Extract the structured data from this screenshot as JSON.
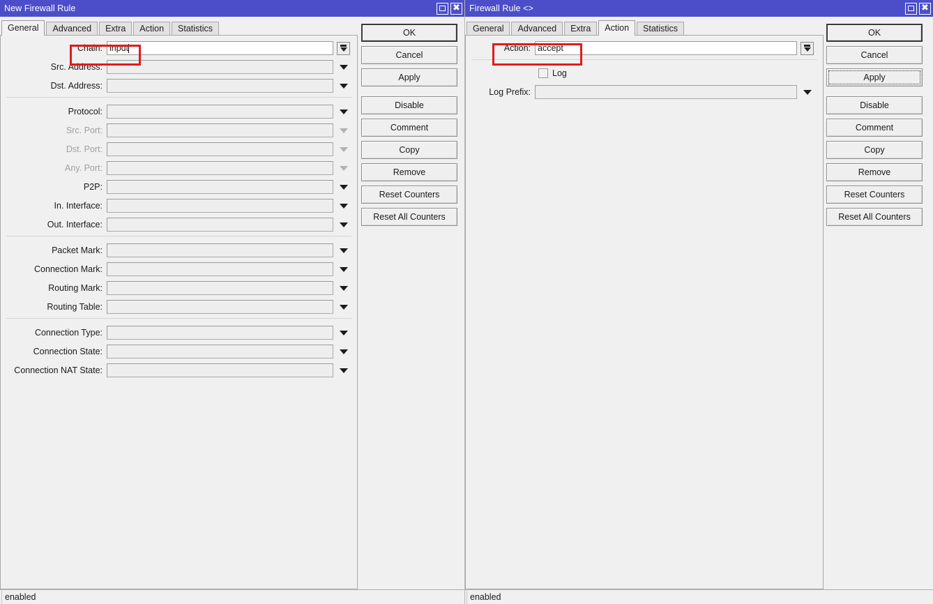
{
  "left_window": {
    "title": "New Firewall Rule",
    "titlebar_color": "#4b4ec8",
    "controls": {
      "maximize": "maximize-restore",
      "close": "close"
    },
    "tabs": [
      {
        "label": "General",
        "active": true
      },
      {
        "label": "Advanced",
        "active": false
      },
      {
        "label": "Extra",
        "active": false
      },
      {
        "label": "Action",
        "active": false
      },
      {
        "label": "Statistics",
        "active": false
      }
    ],
    "fields": [
      {
        "label": "Chain:",
        "value": "input",
        "editable": true,
        "dim": false,
        "control": "dropdown-button",
        "highlight": true
      },
      {
        "label": "Src. Address:",
        "value": "",
        "editable": false,
        "dim": false,
        "control": "triangle"
      },
      {
        "label": "Dst. Address:",
        "value": "",
        "editable": false,
        "dim": false,
        "control": "triangle"
      },
      {
        "label": "Protocol:",
        "value": "",
        "editable": false,
        "dim": false,
        "control": "triangle"
      },
      {
        "label": "Src. Port:",
        "value": "",
        "editable": false,
        "dim": true,
        "control": "triangle-dim"
      },
      {
        "label": "Dst. Port:",
        "value": "",
        "editable": false,
        "dim": true,
        "control": "triangle-dim"
      },
      {
        "label": "Any. Port:",
        "value": "",
        "editable": false,
        "dim": true,
        "control": "triangle-dim"
      },
      {
        "label": "P2P:",
        "value": "",
        "editable": false,
        "dim": false,
        "control": "triangle"
      },
      {
        "label": "In. Interface:",
        "value": "",
        "editable": false,
        "dim": false,
        "control": "triangle"
      },
      {
        "label": "Out. Interface:",
        "value": "",
        "editable": false,
        "dim": false,
        "control": "triangle"
      },
      {
        "label": "Packet Mark:",
        "value": "",
        "editable": false,
        "dim": false,
        "control": "triangle"
      },
      {
        "label": "Connection Mark:",
        "value": "",
        "editable": false,
        "dim": false,
        "control": "triangle"
      },
      {
        "label": "Routing Mark:",
        "value": "",
        "editable": false,
        "dim": false,
        "control": "triangle"
      },
      {
        "label": "Routing Table:",
        "value": "",
        "editable": false,
        "dim": false,
        "control": "triangle"
      },
      {
        "label": "Connection Type:",
        "value": "",
        "editable": false,
        "dim": false,
        "control": "triangle"
      },
      {
        "label": "Connection State:",
        "value": "",
        "editable": false,
        "dim": false,
        "control": "triangle"
      },
      {
        "label": "Connection NAT State:",
        "value": "",
        "editable": false,
        "dim": false,
        "control": "triangle"
      }
    ],
    "buttons": [
      {
        "label": "OK",
        "state": "default"
      },
      {
        "label": "Cancel",
        "state": "normal"
      },
      {
        "label": "Apply",
        "state": "normal"
      },
      {
        "label": "Disable",
        "state": "normal"
      },
      {
        "label": "Comment",
        "state": "normal"
      },
      {
        "label": "Copy",
        "state": "normal"
      },
      {
        "label": "Remove",
        "state": "normal"
      },
      {
        "label": "Reset Counters",
        "state": "normal"
      },
      {
        "label": "Reset All Counters",
        "state": "normal"
      }
    ],
    "status": "enabled"
  },
  "right_window": {
    "title": "Firewall Rule <>",
    "titlebar_color": "#4b4ec8",
    "controls": {
      "maximize": "maximize-restore",
      "close": "close"
    },
    "tabs": [
      {
        "label": "General",
        "active": false
      },
      {
        "label": "Advanced",
        "active": false
      },
      {
        "label": "Extra",
        "active": false
      },
      {
        "label": "Action",
        "active": true
      },
      {
        "label": "Statistics",
        "active": false
      }
    ],
    "fields": [
      {
        "label": "Action:",
        "value": "accept",
        "editable": true,
        "dim": false,
        "control": "dropdown-button",
        "highlight": true
      },
      {
        "label": "Log Prefix:",
        "value": "",
        "editable": false,
        "dim": false,
        "control": "triangle"
      }
    ],
    "checkbox": {
      "label": "Log",
      "checked": false
    },
    "buttons": [
      {
        "label": "OK",
        "state": "default"
      },
      {
        "label": "Cancel",
        "state": "normal"
      },
      {
        "label": "Apply",
        "state": "focused"
      },
      {
        "label": "Disable",
        "state": "normal"
      },
      {
        "label": "Comment",
        "state": "normal"
      },
      {
        "label": "Copy",
        "state": "normal"
      },
      {
        "label": "Remove",
        "state": "normal"
      },
      {
        "label": "Reset Counters",
        "state": "normal"
      },
      {
        "label": "Reset All Counters",
        "state": "normal"
      }
    ],
    "status": "enabled"
  },
  "annotation": {
    "color": "#e01b1b",
    "boxes": [
      {
        "target": "chain-field",
        "window": "left"
      },
      {
        "target": "action-field",
        "window": "right"
      }
    ]
  }
}
